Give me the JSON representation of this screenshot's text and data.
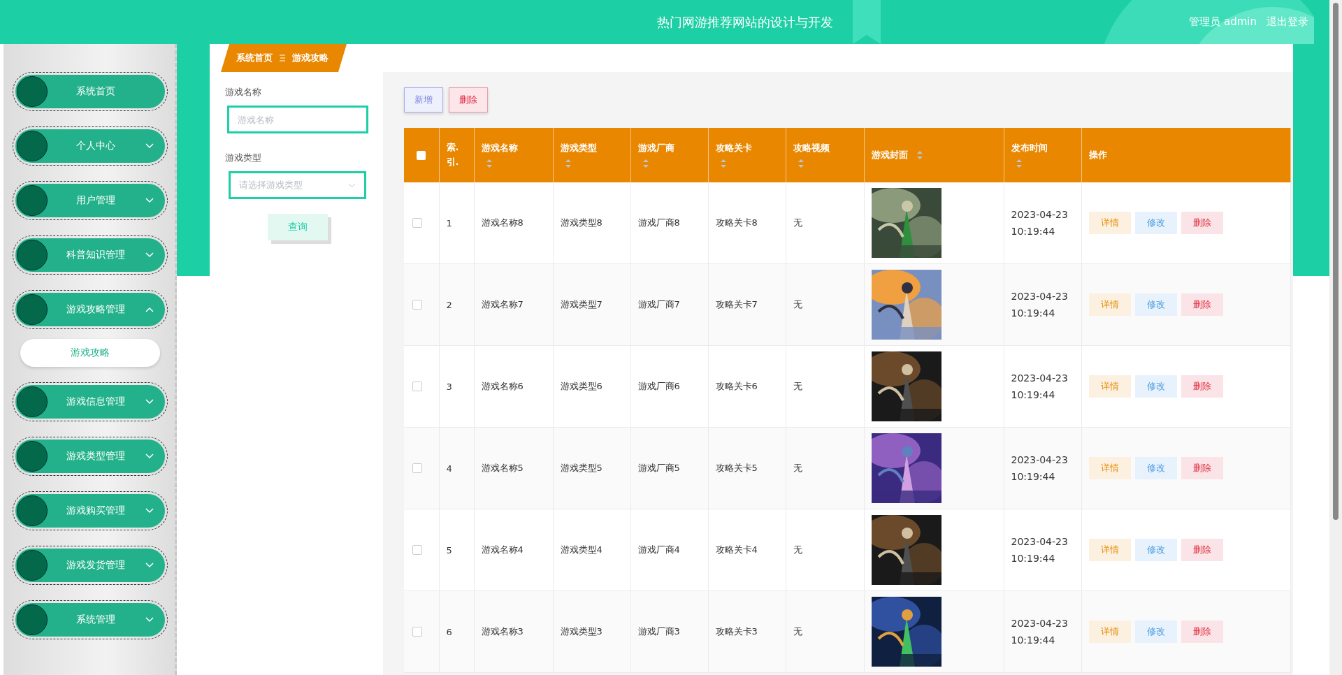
{
  "header": {
    "title": "热门网游推荐网站的设计与开发",
    "user": "管理员 admin",
    "logout": "退出登录"
  },
  "sidebar": {
    "items": [
      {
        "label": "系统首页",
        "kind": "link"
      },
      {
        "label": "个人中心",
        "kind": "menu",
        "expanded": false
      },
      {
        "label": "用户管理",
        "kind": "menu",
        "expanded": false
      },
      {
        "label": "科普知识管理",
        "kind": "menu",
        "expanded": false
      },
      {
        "label": "游戏攻略管理",
        "kind": "menu",
        "expanded": true,
        "children": [
          {
            "label": "游戏攻略"
          }
        ]
      },
      {
        "label": "游戏信息管理",
        "kind": "menu",
        "expanded": false
      },
      {
        "label": "游戏类型管理",
        "kind": "menu",
        "expanded": false
      },
      {
        "label": "游戏购买管理",
        "kind": "menu",
        "expanded": false
      },
      {
        "label": "游戏发货管理",
        "kind": "menu",
        "expanded": false
      },
      {
        "label": "系统管理",
        "kind": "menu",
        "expanded": false
      }
    ]
  },
  "breadcrumb": [
    "系统首页",
    "游戏攻略"
  ],
  "filters": [
    {
      "label": "游戏名称",
      "kind": "input",
      "placeholder": "游戏名称"
    },
    {
      "label": "游戏类型",
      "kind": "select",
      "placeholder": "请选择游戏类型"
    }
  ],
  "search_button": "查询",
  "toolbar": [
    {
      "label": "新增",
      "kind": "add"
    },
    {
      "label": "删除",
      "kind": "delete"
    }
  ],
  "table": {
    "select_all_checked": false,
    "columns": [
      {
        "label": "索.引.",
        "sortable": false
      },
      {
        "label": "游戏名称",
        "sortable": true
      },
      {
        "label": "游戏类型",
        "sortable": true
      },
      {
        "label": "游戏厂商",
        "sortable": true
      },
      {
        "label": "攻略关卡",
        "sortable": true
      },
      {
        "label": "攻略视频",
        "sortable": true
      },
      {
        "label": "游戏封面",
        "sortable": true
      },
      {
        "label": "发布时间",
        "sortable": true
      },
      {
        "label": "操作",
        "sortable": false
      }
    ],
    "rows": [
      {
        "checked": false,
        "cells": [
          "1",
          "游戏名称8",
          "游戏类型8",
          "游戏厂商8",
          "攻略关卡8",
          "无"
        ],
        "date": "2023-04-23",
        "time": "10:19:44",
        "actions": [
          "详情",
          "修改",
          "删除"
        ]
      },
      {
        "checked": false,
        "cells": [
          "2",
          "游戏名称7",
          "游戏类型7",
          "游戏厂商7",
          "攻略关卡7",
          "无"
        ],
        "date": "2023-04-23",
        "time": "10:19:44",
        "actions": [
          "详情",
          "修改",
          "删除"
        ]
      },
      {
        "checked": false,
        "cells": [
          "3",
          "游戏名称6",
          "游戏类型6",
          "游戏厂商6",
          "攻略关卡6",
          "无"
        ],
        "date": "2023-04-23",
        "time": "10:19:44",
        "actions": [
          "详情",
          "修改",
          "删除"
        ]
      },
      {
        "checked": false,
        "cells": [
          "4",
          "游戏名称5",
          "游戏类型5",
          "游戏厂商5",
          "攻略关卡5",
          "无"
        ],
        "date": "2023-04-23",
        "time": "10:19:44",
        "actions": [
          "详情",
          "修改",
          "删除"
        ]
      },
      {
        "checked": false,
        "cells": [
          "5",
          "游戏名称4",
          "游戏类型4",
          "游戏厂商4",
          "攻略关卡4",
          "无"
        ],
        "date": "2023-04-23",
        "time": "10:19:44",
        "actions": [
          "详情",
          "修改",
          "删除"
        ]
      },
      {
        "checked": false,
        "cells": [
          "6",
          "游戏名称3",
          "游戏类型3",
          "游戏厂商3",
          "攻略关卡3",
          "无"
        ],
        "date": "2023-04-23",
        "time": "10:19:44",
        "actions": [
          "详情",
          "修改",
          "删除"
        ]
      }
    ]
  }
}
